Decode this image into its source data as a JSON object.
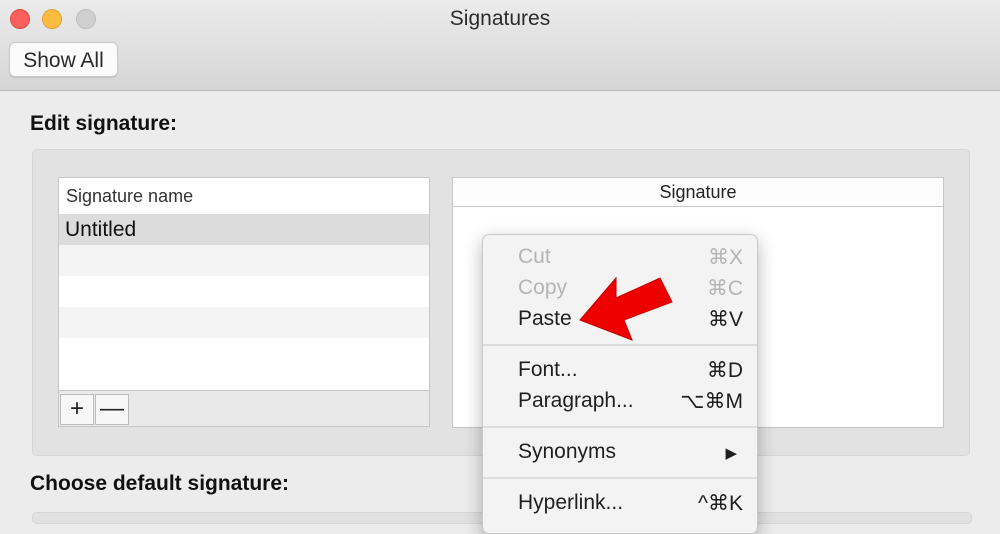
{
  "window": {
    "title": "Signatures"
  },
  "toolbar": {
    "show_all_label": "Show All"
  },
  "edit_section": {
    "title": "Edit signature:"
  },
  "signature_list": {
    "header": "Signature name",
    "items": [
      "Untitled"
    ],
    "add_label": "+",
    "remove_label": "—"
  },
  "signature_editor": {
    "header": "Signature"
  },
  "choose_section": {
    "title": "Choose default signature:"
  },
  "context_menu": {
    "items": [
      {
        "label": "Cut",
        "shortcut": "⌘X",
        "enabled": false
      },
      {
        "label": "Copy",
        "shortcut": "⌘C",
        "enabled": false
      },
      {
        "label": "Paste",
        "shortcut": "⌘V",
        "enabled": true
      },
      {
        "label": "Font...",
        "shortcut": "⌘D",
        "enabled": true
      },
      {
        "label": "Paragraph...",
        "shortcut": "⌥⌘M",
        "enabled": true
      },
      {
        "label": "Synonyms",
        "shortcut": "▶",
        "enabled": true
      },
      {
        "label": "Hyperlink...",
        "shortcut": "^⌘K",
        "enabled": true
      }
    ]
  },
  "colors": {
    "close": "#fc605c",
    "minimize": "#fdbc40",
    "zoom_inactive": "#cfcfcf",
    "annotation_arrow": "#ee0000"
  },
  "icons": {
    "annotation": "red-arrow-icon",
    "submenu": "triangle-right-icon"
  }
}
